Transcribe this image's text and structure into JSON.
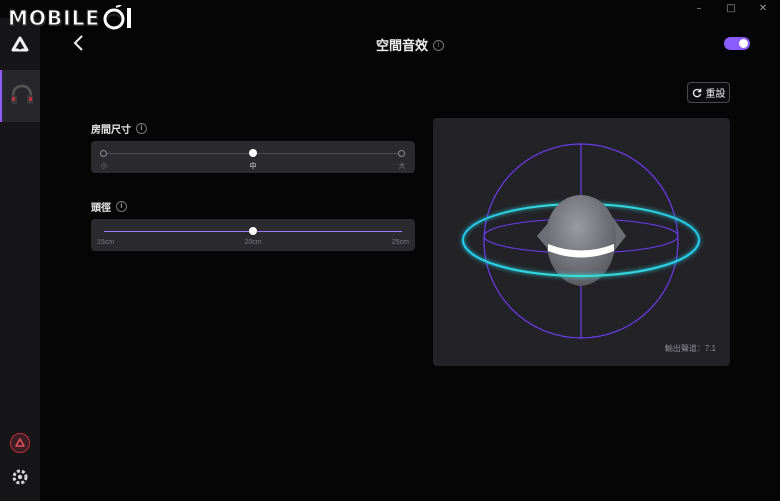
{
  "watermark": {
    "text": "MOBILE"
  },
  "window": {
    "min": "–",
    "max": "□",
    "close": "✕"
  },
  "sidebar": {
    "logo_icon": "app-logo-icon",
    "device_icon": "headset-icon",
    "profile_icon": "profile-icon",
    "settings_icon": "gear-icon"
  },
  "header": {
    "back_icon": "chevron-left-icon",
    "title": "空間音效",
    "info_icon": "info-icon",
    "toggle_on": true,
    "accent": "#8a5cff"
  },
  "reset": {
    "label": "重設",
    "icon": "refresh-icon"
  },
  "room_size": {
    "label": "房間尺寸",
    "options": [
      "小",
      "中",
      "大"
    ],
    "selected": "中",
    "selected_index": 1
  },
  "head_size": {
    "label": "頭徑",
    "min_label": "15cm",
    "mid_label": "20cm",
    "max_label": "25cm",
    "value": "20cm",
    "fraction": 0.5
  },
  "visualizer": {
    "footer": "輸出聲道：7.1",
    "ring_colors": [
      "#6a3cf0",
      "#27d7e6"
    ]
  }
}
